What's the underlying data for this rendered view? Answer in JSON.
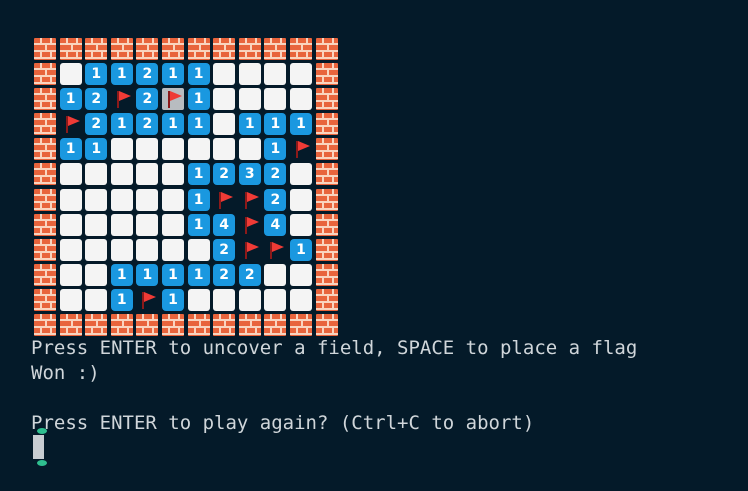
{
  "game": {
    "board": [
      "WWWWWWWWWWWW",
      "W.11211....W",
      "W12F2C1....W",
      "WF21211.111W",
      "W11......1FW",
      "W.....1232.W",
      "W.....1FF2.W",
      "W.....14F4.W",
      "W......2FF1W",
      "W..111122..W",
      "W..1F1.....W",
      "WWWWWWWWWWWW"
    ],
    "colors": {
      "background": "#041a29",
      "number_tile": "#1a98e0",
      "blank_tile": "#f4f4f4",
      "flag": "#ef3b36",
      "brick": "#e8643c",
      "cursor": "#b8bcc0"
    },
    "icons": {
      "wall": "brick-icon",
      "flag": "flag-icon"
    }
  },
  "terminal": {
    "instructions": "Press ENTER to uncover a field, SPACE to place a flag",
    "status": "Won :)",
    "prompt": "Press ENTER to play again? (Ctrl+C to abort)"
  }
}
